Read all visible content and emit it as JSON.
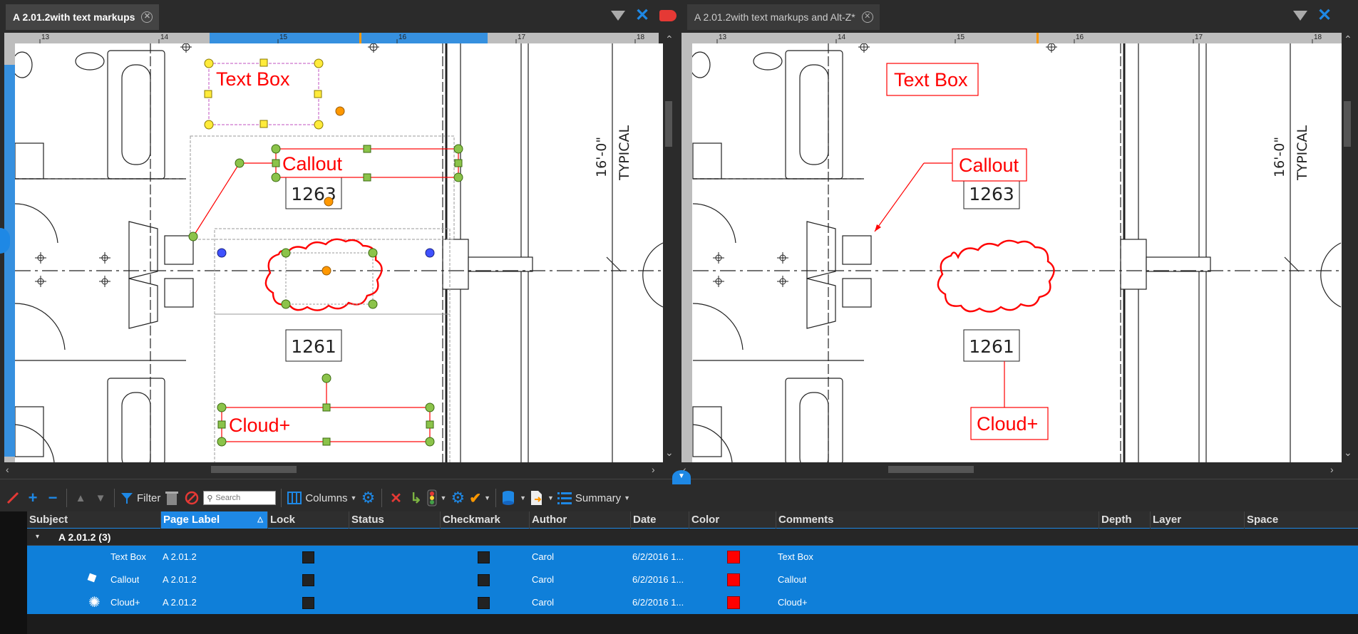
{
  "left_pane": {
    "tab_title": "A 2.01.2with text markups",
    "ruler_labels": [
      "13",
      "14",
      "15",
      "16",
      "17",
      "18"
    ],
    "markups": {
      "text_box": "Text Box",
      "callout": "Callout",
      "cloud": "Cloud+"
    },
    "rooms": [
      "1263",
      "1261"
    ],
    "dimension": "16'-0\"",
    "typical": "TYPICAL"
  },
  "right_pane": {
    "tab_title": "A 2.01.2with text markups and Alt-Z*",
    "ruler_labels": [
      "13",
      "14",
      "15",
      "16",
      "17",
      "18"
    ],
    "markups": {
      "text_box": "Text Box",
      "callout": "Callout",
      "cloud": "Cloud+"
    },
    "rooms": [
      "1263",
      "1261"
    ],
    "dimension": "16'-0\"",
    "typical": "TYPICAL"
  },
  "toolbar": {
    "filter_label": "Filter",
    "search_placeholder": "Search",
    "columns_label": "Columns",
    "summary_label": "Summary"
  },
  "grid": {
    "columns": [
      "Subject",
      "Page Label",
      "Lock",
      "Status",
      "Checkmark",
      "Author",
      "Date",
      "Color",
      "Comments",
      "Depth",
      "Layer",
      "Space"
    ],
    "sorted_column": "Page Label",
    "group": {
      "label": "A 2.01.2 (3)"
    },
    "rows": [
      {
        "subject": "Text Box",
        "page_label": "A 2.01.2",
        "author": "Carol",
        "date": "6/2/2016 1...",
        "color": "#ff0000",
        "comments": "Text Box",
        "icon": "text-box-icon"
      },
      {
        "subject": "Callout",
        "page_label": "A 2.01.2",
        "author": "Carol",
        "date": "6/2/2016 1...",
        "color": "#ff0000",
        "comments": "Callout",
        "icon": "callout-icon"
      },
      {
        "subject": "Cloud+",
        "page_label": "A 2.01.2",
        "author": "Carol",
        "date": "6/2/2016 1...",
        "color": "#ff0000",
        "comments": "Cloud+",
        "icon": "cloud-icon"
      }
    ]
  },
  "colors": {
    "accent": "#1e88e5",
    "markup_red": "#ff0000",
    "handle_yellow": "#ffeb3b",
    "handle_green": "#8bc34a",
    "handle_orange": "#ff9800"
  }
}
